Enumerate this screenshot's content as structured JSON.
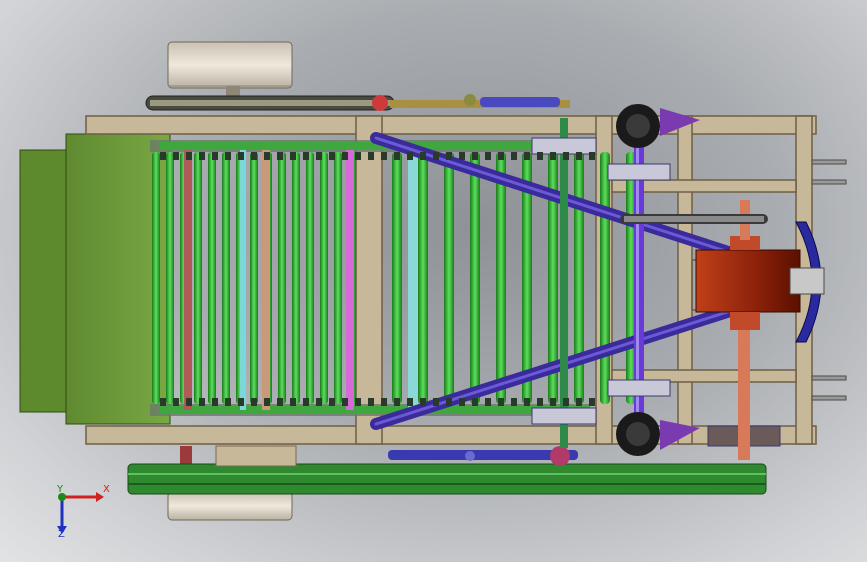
{
  "scene": {
    "colors": {
      "background": "#a9acb0",
      "frame": "#c8b89a",
      "hopper_green": "#6f9a3c",
      "roller_green": "#2fbf2f",
      "strut_purple": "#3a2a9a",
      "gearbox_red": "#a03010",
      "belt_green": "#2f8a2f",
      "wheel_tan": "#d8d0c0",
      "shaft_salmon": "#d87a5a",
      "impeller_blue": "#2a2aa0"
    }
  },
  "triad": {
    "x_label": "X",
    "y_label": "Y",
    "z_label": "Z"
  }
}
